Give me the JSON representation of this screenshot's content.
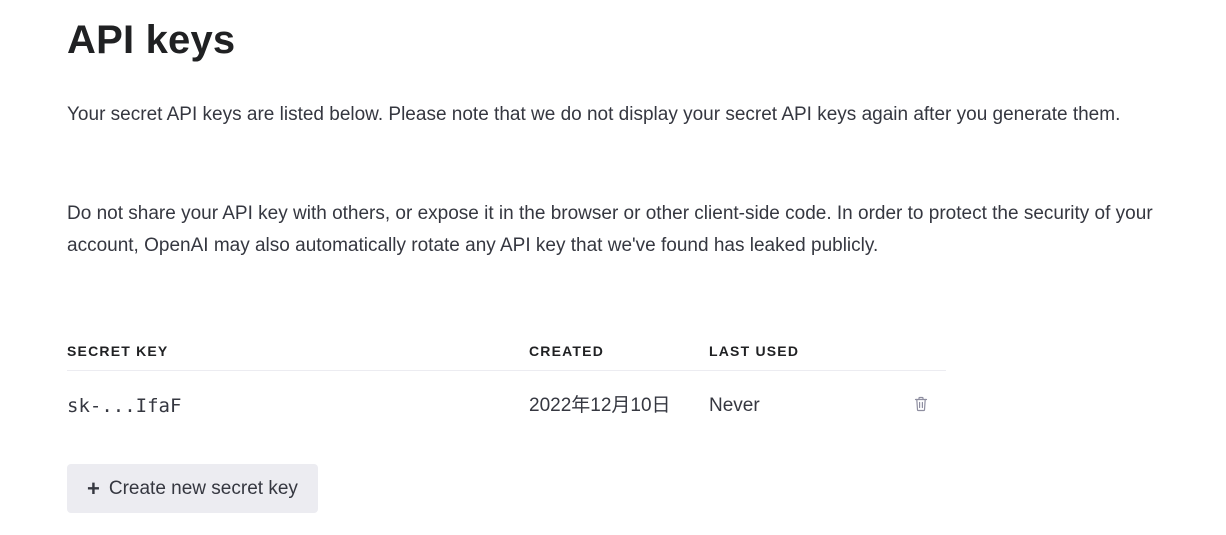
{
  "page": {
    "title": "API keys",
    "paragraphs": [
      "Your secret API keys are listed below. Please note that we do not display your secret API keys again after you generate them.",
      "Do not share your API key with others, or expose it in the browser or other client-side code. In order to protect the security of your account, OpenAI may also automatically rotate any API key that we've found has leaked publicly."
    ]
  },
  "keys_table": {
    "columns": [
      "SECRET KEY",
      "CREATED",
      "LAST USED",
      ""
    ],
    "rows": [
      {
        "secret_key": "sk-...IfaF",
        "created": "2022年12月10日",
        "last_used": "Never",
        "action_icon": "trash-icon"
      }
    ]
  },
  "actions": {
    "create_label": "Create new secret key",
    "create_icon": "+"
  },
  "colors": {
    "text": "#353740",
    "heading": "#202123",
    "button_bg": "#ececf1",
    "icon": "#8e8ea0",
    "divider": "#ececf1"
  }
}
